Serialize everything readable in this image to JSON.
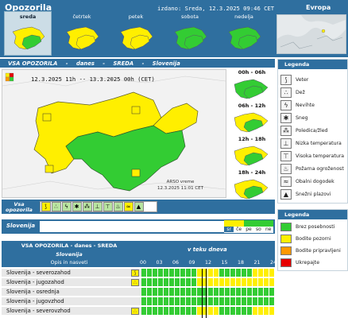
{
  "header": {
    "title": "Opozorila",
    "issued": "izdano: Sreda, 12.3.2025 09:46 CET",
    "europe_link": "Evropa"
  },
  "days": [
    {
      "label": "sreda",
      "active": true
    },
    {
      "label": "četrtek",
      "active": false
    },
    {
      "label": "petek",
      "active": false
    },
    {
      "label": "sobota",
      "active": false
    },
    {
      "label": "nedelja",
      "active": false
    }
  ],
  "all_warnings": {
    "title": "VSA OPOZORILA",
    "sep1": "-",
    "when": "danes",
    "sep2": "-",
    "day": "SREDA",
    "sep3": "-",
    "region": "Slovenija"
  },
  "map": {
    "period": "12.3.2025 11h -- 13.3.2025 00h   (CET)",
    "credit_line1": "ARSO vreme",
    "credit_line2": "12.3.2025  11:01 CET"
  },
  "thumbnails": [
    {
      "label": "00h - 06h"
    },
    {
      "label": "06h - 12h"
    },
    {
      "label": "12h - 18h"
    },
    {
      "label": "18h - 24h"
    }
  ],
  "type_row": {
    "label_line1": "Vsa",
    "label_line2": "opozorila"
  },
  "slovenija_row": {
    "label": "Slovenija",
    "week_days": [
      "sr",
      "če",
      "pe",
      "so",
      "ne"
    ],
    "week_levels": [
      "yellow",
      "yellow",
      "green",
      "green",
      "green"
    ]
  },
  "table": {
    "title": "VSA OPOZORILA - danes - SREDA",
    "subtitle": "Slovenija",
    "during_day": "v teku dneva",
    "column_label": "Opis in nasveti",
    "hours": [
      "00",
      "03",
      "06",
      "09",
      "12",
      "15",
      "18",
      "21",
      "24"
    ],
    "rows": [
      {
        "name": "Slovenija - severozahod",
        "icon": "wind",
        "cells": [
          "g",
          "g",
          "g",
          "g",
          "g",
          "g",
          "g",
          "g",
          "g",
          "g",
          "y",
          "y",
          "y",
          "y",
          "g",
          "g",
          "g",
          "g",
          "g",
          "g",
          "y",
          "y",
          "y",
          "y"
        ]
      },
      {
        "name": "Slovenija - jugozahod",
        "icon": "rain",
        "cells": [
          "g",
          "g",
          "g",
          "g",
          "g",
          "g",
          "g",
          "g",
          "g",
          "g",
          "y",
          "y",
          "y",
          "y",
          "y",
          "y",
          "y",
          "y",
          "y",
          "y",
          "y",
          "y",
          "y",
          "y"
        ]
      },
      {
        "name": "Slovenija - osrednja",
        "icon": "",
        "cells": [
          "g",
          "g",
          "g",
          "g",
          "g",
          "g",
          "g",
          "g",
          "g",
          "g",
          "g",
          "g",
          "g",
          "g",
          "g",
          "g",
          "g",
          "g",
          "g",
          "g",
          "g",
          "g",
          "g",
          "g"
        ]
      },
      {
        "name": "Slovenija - jugovzhod",
        "icon": "",
        "cells": [
          "g",
          "g",
          "g",
          "g",
          "g",
          "g",
          "g",
          "g",
          "g",
          "g",
          "g",
          "g",
          "g",
          "g",
          "g",
          "g",
          "g",
          "g",
          "g",
          "g",
          "g",
          "g",
          "g",
          "g"
        ]
      },
      {
        "name": "Slovenija - severovzhod",
        "icon": "rain",
        "cells": [
          "g",
          "g",
          "g",
          "g",
          "g",
          "g",
          "g",
          "g",
          "g",
          "g",
          "y",
          "y",
          "y",
          "y",
          "g",
          "g",
          "g",
          "g",
          "g",
          "g",
          "y",
          "y",
          "y",
          "y"
        ]
      }
    ]
  },
  "legend": {
    "title": "Legenda",
    "items": [
      {
        "label": "Veter",
        "icon": "wind-icon",
        "glyph": "⟆"
      },
      {
        "label": "Dež",
        "icon": "rain-icon",
        "glyph": "∴"
      },
      {
        "label": "Nevihte",
        "icon": "thunderstorm-icon",
        "glyph": "ϟ"
      },
      {
        "label": "Sneg",
        "icon": "snow-icon",
        "glyph": "✱"
      },
      {
        "label": "Poledica/žled",
        "icon": "ice-icon",
        "glyph": "⁂"
      },
      {
        "label": "Nizka temperatura",
        "icon": "low-temperature-icon",
        "glyph": "⊥"
      },
      {
        "label": "Visoka temperatura",
        "icon": "high-temperature-icon",
        "glyph": "⊤"
      },
      {
        "label": "Požarna ogroženost",
        "icon": "fire-icon",
        "glyph": "♨"
      },
      {
        "label": "Obalni dogodek",
        "icon": "coastal-event-icon",
        "glyph": "≈"
      },
      {
        "label": "Snežni plazovi",
        "icon": "avalanche-icon",
        "glyph": "▲"
      }
    ]
  },
  "levels": {
    "title": "Legenda",
    "items": [
      {
        "label": "Brez posebnosti",
        "color": "#33cc33"
      },
      {
        "label": "Bodite pozorni",
        "color": "#ffef00"
      },
      {
        "label": "Bodite pripravljeni",
        "color": "#ff9900"
      },
      {
        "label": "Ukrepajte",
        "color": "#e60000"
      }
    ]
  },
  "colors": {
    "green": "#33cc33",
    "yellow": "#ffef00",
    "header": "#2f6f9f"
  }
}
